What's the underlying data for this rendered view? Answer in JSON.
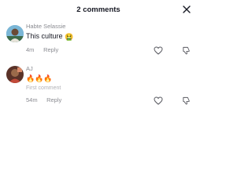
{
  "header": {
    "title": "2 comments",
    "close_icon": "close-icon"
  },
  "comments": [
    {
      "username": "Habte Selassie",
      "text": "This culture",
      "emoji": "🤮",
      "time": "4m",
      "reply_label": "Reply",
      "like_icon": "heart-outline-icon",
      "dislike_icon": "thumbs-down-icon"
    },
    {
      "username": "AJ",
      "text": "🔥🔥🔥",
      "first_label": "First comment",
      "time": "54m",
      "reply_label": "Reply",
      "like_icon": "heart-outline-icon",
      "dislike_icon": "thumbs-down-icon"
    }
  ],
  "colors": {
    "text": "#161823",
    "secondary": "#8a8b91",
    "background": "#ffffff",
    "accent": "#ff3b5c"
  }
}
